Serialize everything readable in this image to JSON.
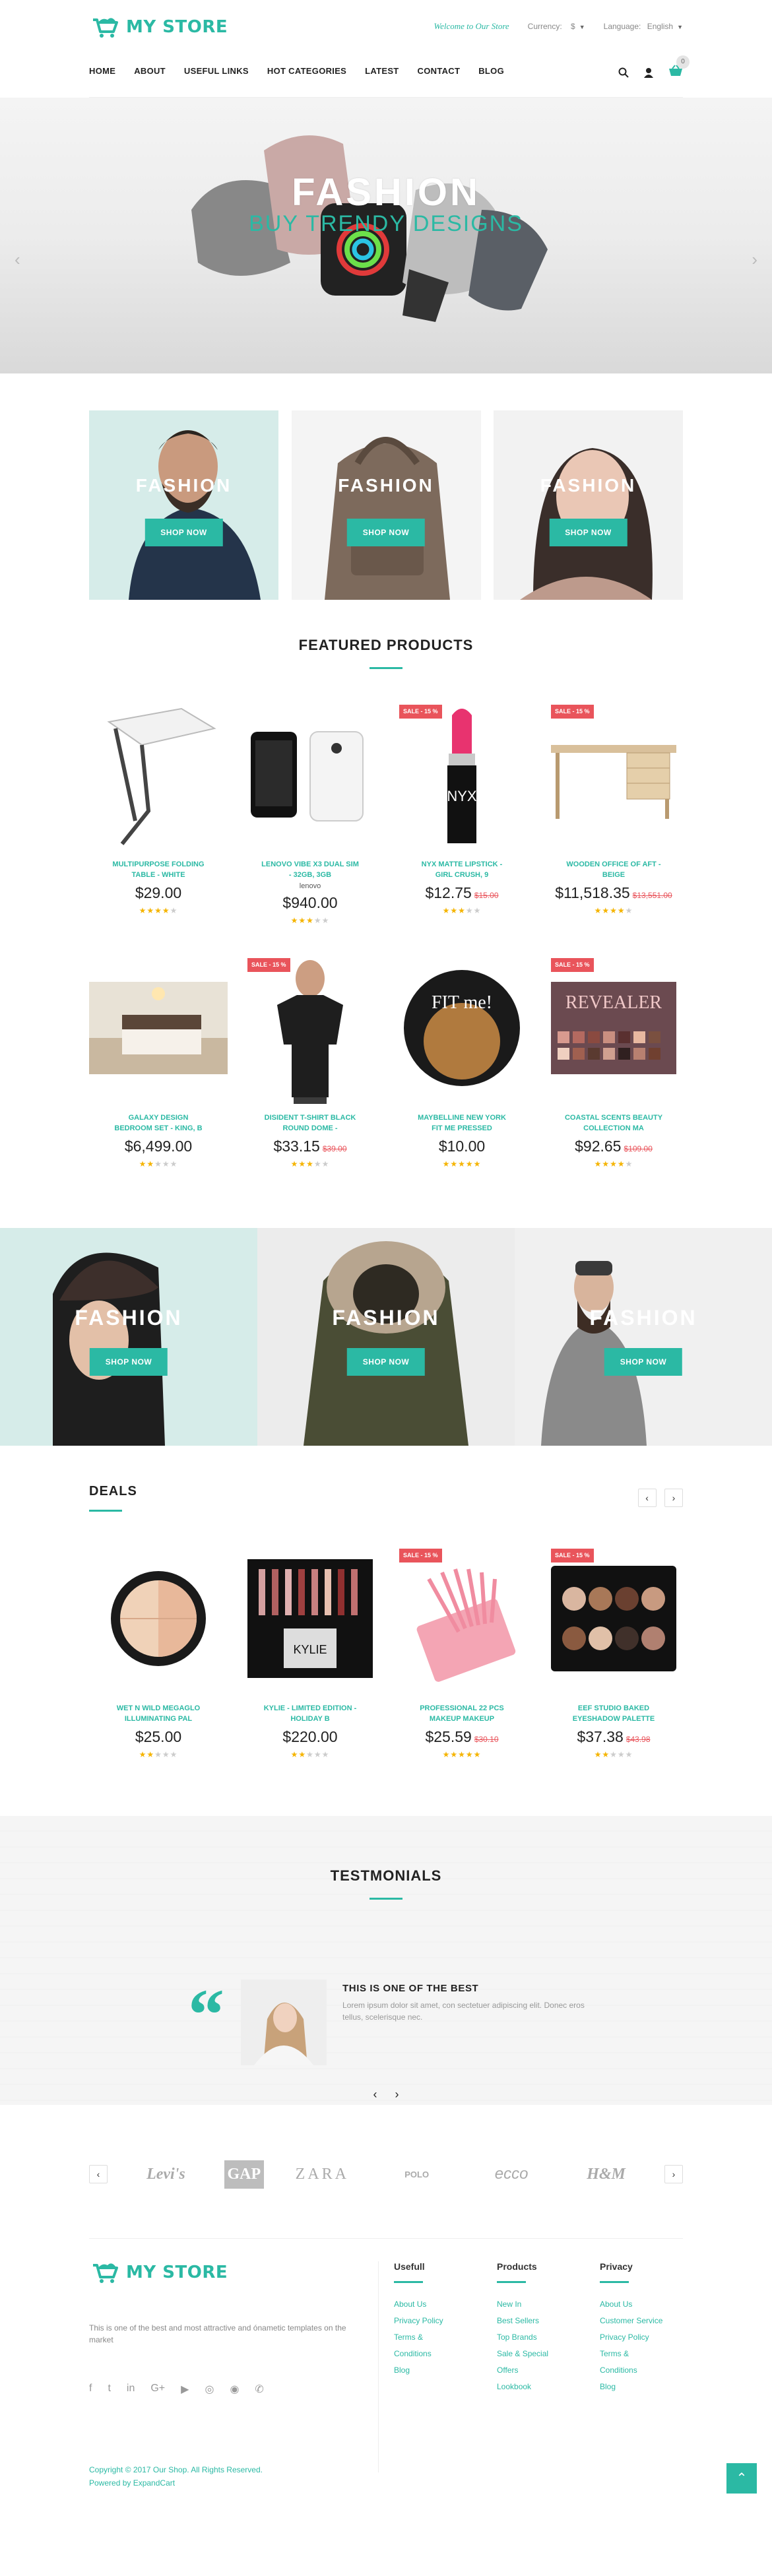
{
  "brand": {
    "name": "MY STORE"
  },
  "top": {
    "welcome": "Welcome to Our Store",
    "currency_label": "Currency:",
    "currency_value": "$",
    "language_label": "Language:",
    "language_value": "English"
  },
  "nav": [
    "HOME",
    "ABOUT",
    "USEFUL LINKS",
    "HOT CATEGORIES",
    "LATEST",
    "CONTACT",
    "BLOG"
  ],
  "cart_count": "0",
  "hero": {
    "title": "FASHION",
    "subtitle": "BUY TRENDY DESIGNS"
  },
  "banners": [
    {
      "title": "FASHION",
      "button": "SHOP NOW"
    },
    {
      "title": "FASHION",
      "button": "SHOP NOW"
    },
    {
      "title": "FASHION",
      "button": "SHOP NOW"
    }
  ],
  "featured": {
    "title": "FEATURED PRODUCTS",
    "products": [
      {
        "name": "MULTIPURPOSE FOLDING TABLE - WHITE",
        "brand": "",
        "price": "$29.00",
        "old": "",
        "rating": 4,
        "sale": "",
        "icon": "folding-table"
      },
      {
        "name": "LENOVO VIBE X3 DUAL SIM - 32GB, 3GB",
        "brand": "lenovo",
        "price": "$940.00",
        "old": "",
        "rating": 3,
        "sale": "",
        "icon": "phone"
      },
      {
        "name": "NYX MATTE LIPSTICK - GIRL CRUSH, 9",
        "brand": "",
        "price": "$12.75",
        "old": "$15.00",
        "rating": 3,
        "sale": "SALE - 15 %",
        "icon": "lipstick"
      },
      {
        "name": "WOODEN OFFICE OF AFT - BEIGE",
        "brand": "",
        "price": "$11,518.35",
        "old": "$13,551.00",
        "rating": 4,
        "sale": "SALE - 15 %",
        "icon": "desk"
      },
      {
        "name": "GALAXY DESIGN BEDROOM SET - KING, B",
        "brand": "",
        "price": "$6,499.00",
        "old": "",
        "rating": 2,
        "sale": "",
        "icon": "bedroom"
      },
      {
        "name": "DISIDENT T-SHIRT BLACK ROUND DOME -",
        "brand": "",
        "price": "$33.15",
        "old": "$39.00",
        "rating": 3,
        "sale": "SALE - 15 %",
        "icon": "tshirt"
      },
      {
        "name": "MAYBELLINE NEW YORK FIT ME PRESSED",
        "brand": "",
        "price": "$10.00",
        "old": "",
        "rating": 5,
        "sale": "",
        "icon": "powder"
      },
      {
        "name": "COASTAL SCENTS BEAUTY COLLECTION MA",
        "brand": "",
        "price": "$92.65",
        "old": "$109.00",
        "rating": 4,
        "sale": "SALE - 15 %",
        "icon": "palette"
      }
    ]
  },
  "wide_banners": [
    {
      "title": "FASHION",
      "button": "SHOP NOW"
    },
    {
      "title": "FASHION",
      "button": "SHOP NOW"
    },
    {
      "title": "FASHION",
      "button": "SHOP NOW"
    }
  ],
  "deals": {
    "title": "DEALS",
    "products": [
      {
        "name": "WET N WILD MEGAGLO ILLUMINATING PAL",
        "price": "$25.00",
        "old": "",
        "rating": 2,
        "sale": "",
        "icon": "illuminator"
      },
      {
        "name": "KYLIE - LIMITED EDITION - HOLIDAY B",
        "price": "$220.00",
        "old": "",
        "rating": 2,
        "sale": "",
        "icon": "kylie"
      },
      {
        "name": "PROFESSIONAL 22 PCS MAKEUP MAKEUP",
        "price": "$25.59",
        "old": "$30.10",
        "rating": 5,
        "sale": "SALE - 15 %",
        "icon": "brushes"
      },
      {
        "name": "EEF STUDIO BAKED EYESHADOW PALETTE",
        "price": "$37.38",
        "old": "$43.98",
        "rating": 2,
        "sale": "SALE - 15 %",
        "icon": "eyeshadow"
      }
    ]
  },
  "testimonials": {
    "title": "TESTMONIALS",
    "quote_title": "THIS IS ONE OF THE BEST",
    "text": "Lorem ipsum dolor sit amet, con sectetuer adipiscing elit. Donec eros tellus, scelerisque nec."
  },
  "brands": [
    "Levi's",
    "GAP",
    "ZARA",
    "POLO",
    "ecco",
    "H&M"
  ],
  "footer": {
    "desc": "This is one of the best and most attractive and ónametic templates on the market",
    "cols": [
      {
        "title": "Usefull",
        "links": [
          "About Us",
          "Privacy Policy",
          "Terms & Conditions",
          "Blog"
        ]
      },
      {
        "title": "Products",
        "links": [
          "New In",
          "Best Sellers",
          "Top Brands",
          "Sale & Special Offers",
          "Lookbook"
        ]
      },
      {
        "title": "Privacy",
        "links": [
          "About Us",
          "Customer Service",
          "Privacy Policy",
          "Terms & Conditions",
          "Blog"
        ]
      }
    ],
    "copyright": "Copyright © 2017 Our Shop. All Rights Reserved.",
    "powered": "Powered by ExpandCart"
  },
  "colors": {
    "accent": "#2bb9a4",
    "sale": "#e9545b",
    "star": "#f5b400"
  }
}
